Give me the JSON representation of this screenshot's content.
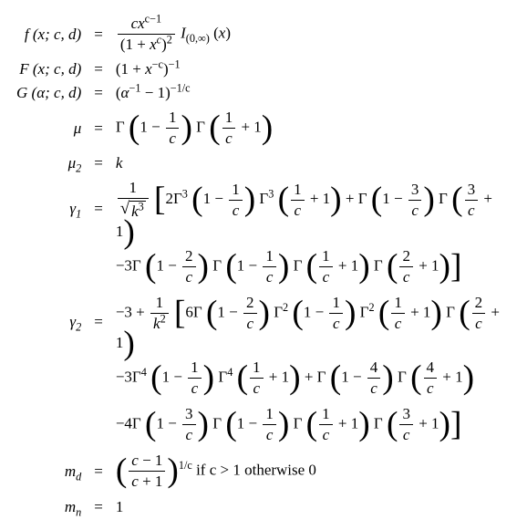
{
  "eq_sign": "=",
  "rows": {
    "r1_lhs": "f (x; c, d)",
    "r2_lhs": "F (x; c, d)",
    "r3_lhs": "G (α; c, d)",
    "r4_lhs": "μ",
    "r5_lhs": "μ",
    "r5_sub": "2",
    "r5_rhs": "k",
    "r6_lhs": "γ",
    "r6_sub": "1",
    "r7_lhs": "γ",
    "r7_sub": "2",
    "r8_lhs": "m",
    "r8_sub": "d",
    "r8_tail": " if c > 1 otherwise 0",
    "r9_lhs": "m",
    "r9_sub": "n",
    "r9_rhs": "1"
  },
  "sym": {
    "gamma_cap": "Γ",
    "c": "c",
    "d": "d",
    "x": "x",
    "k": "k",
    "alpha": "α",
    "one": "1",
    "two": "2",
    "three": "3",
    "four": "4",
    "six": "6",
    "minus3": "−3",
    "minus4": "−4",
    "plus": "+",
    "minus": "−",
    "indicator_I": "I",
    "ind_sub": "(0,∞)",
    "exp_c_minus_1": "c−1",
    "exp_minus1": "−1",
    "exp_minus_c": "−c",
    "exp_minus_1_over_c": "−1/c",
    "exp_1_over_c": "1/c",
    "c_minus_1": "c − 1",
    "c_plus_1": "c + 1",
    "k_cubed": "k",
    "k_sq": "k"
  }
}
